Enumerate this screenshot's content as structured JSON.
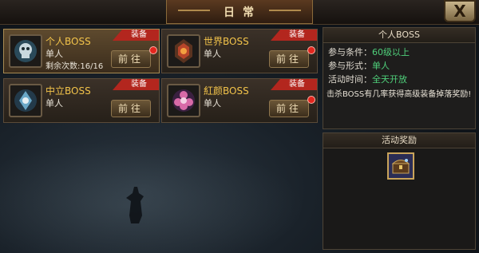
{
  "window": {
    "title": "日常",
    "close_label": "X"
  },
  "bosses": [
    {
      "name": "个人BOSS",
      "type": "单人",
      "remaining": "剩余次数:16/16",
      "tag": "装备",
      "go_label": "前往",
      "icon": "skull-emblem-icon"
    },
    {
      "name": "世界BOSS",
      "type": "单人",
      "tag": "装备",
      "go_label": "前往",
      "icon": "demon-emblem-icon"
    },
    {
      "name": "中立BOSS",
      "type": "单人",
      "tag": "装备",
      "go_label": "前往",
      "icon": "crest-emblem-icon"
    },
    {
      "name": "紅颜BOSS",
      "type": "单人",
      "tag": "装备",
      "go_label": "前往",
      "icon": "flower-emblem-icon"
    }
  ],
  "detail": {
    "header": "个人BOSS",
    "condition_label": "参与条件：",
    "condition_value": "60级以上",
    "mode_label": "参与形式：",
    "mode_value": "单人",
    "time_label": "活动时间：",
    "time_value": "全天开放",
    "description": "击杀BOSS有几率获得高级装备掉落奖励!"
  },
  "reward": {
    "header": "活动奖励",
    "item_icon": "treasure-chest-icon"
  },
  "colors": {
    "gold": "#f2c34a",
    "green": "#4fd07a",
    "tag_red": "#b3261e"
  }
}
